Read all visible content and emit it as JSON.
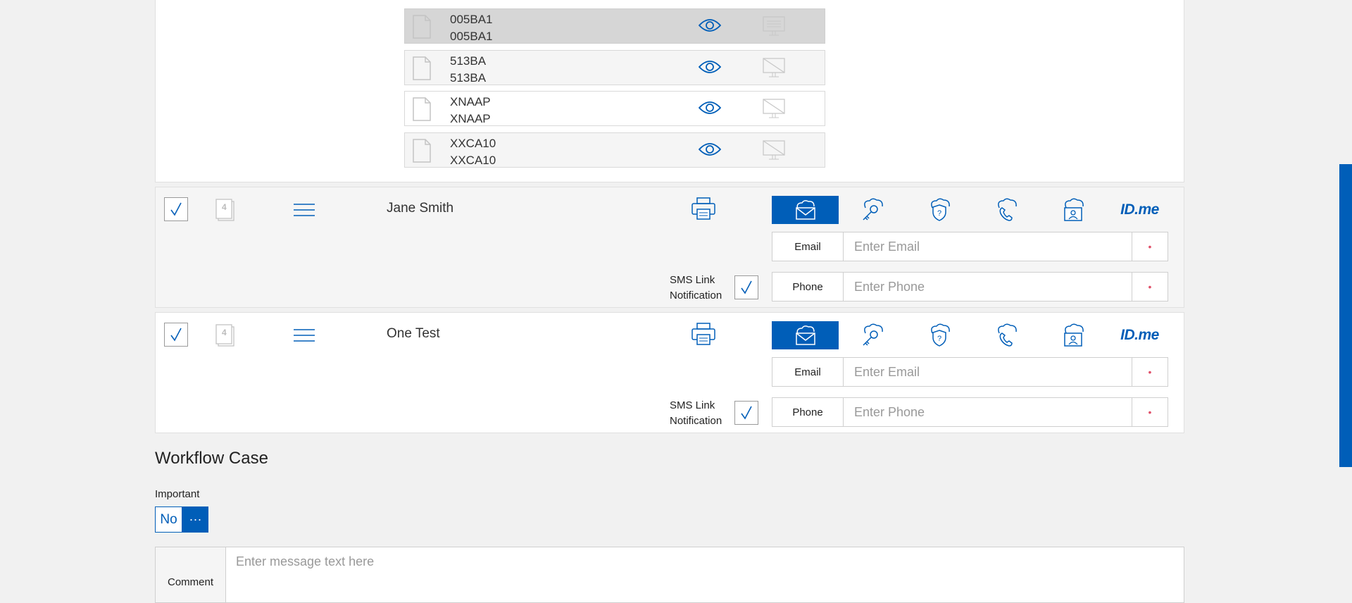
{
  "documents": [
    {
      "line1": "005BA1",
      "line2": "005BA1",
      "selected": true
    },
    {
      "line1": "513BA",
      "line2": "513BA"
    },
    {
      "line1": "XNAAP",
      "line2": "XNAAP"
    },
    {
      "line1": "XXCA10",
      "line2": "XXCA10"
    }
  ],
  "recipients": [
    {
      "name": "Jane Smith",
      "page_count": "4",
      "auth_methods": [
        "email-icon",
        "key-icon",
        "shield-question-icon",
        "phone-icon",
        "cloud-id-icon",
        "idme-logo"
      ],
      "idme_label": "ID.me",
      "email_label": "Email",
      "email_placeholder": "Enter Email",
      "phone_label": "Phone",
      "phone_placeholder": "Enter Phone",
      "required_mark": "•",
      "sms_line1": "SMS Link",
      "sms_line2": "Notification"
    },
    {
      "name": "One Test",
      "page_count": "4",
      "auth_methods": [
        "email-icon",
        "key-icon",
        "shield-question-icon",
        "phone-icon",
        "cloud-id-icon",
        "idme-logo"
      ],
      "idme_label": "ID.me",
      "email_label": "Email",
      "email_placeholder": "Enter Email",
      "phone_label": "Phone",
      "phone_placeholder": "Enter Phone",
      "required_mark": "•",
      "sms_line1": "SMS Link",
      "sms_line2": "Notification"
    }
  ],
  "workflow": {
    "title": "Workflow Case",
    "important_label": "Important",
    "important_value": "No",
    "more_label": "···",
    "comment_label": "Comment",
    "comment_placeholder": "Enter message text here"
  },
  "colors": {
    "accent": "#005eb8",
    "required": "#e0506a"
  }
}
